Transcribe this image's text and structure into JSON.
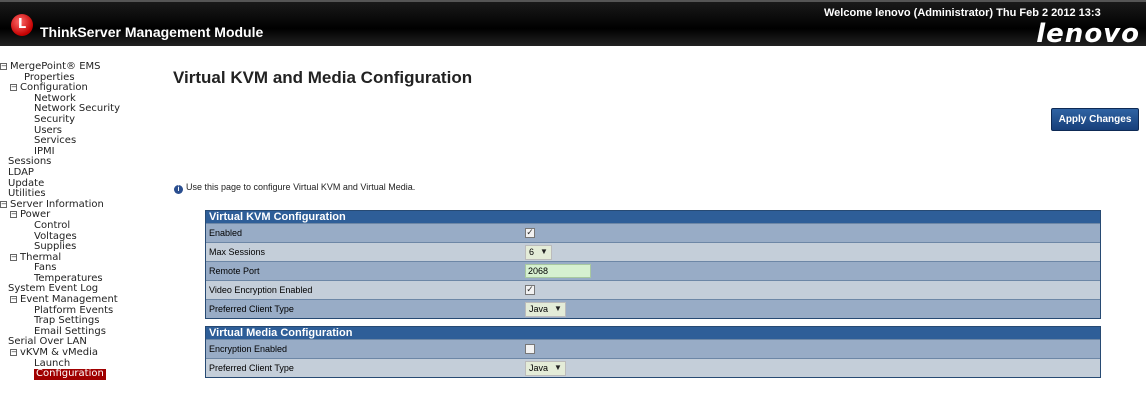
{
  "header": {
    "logo_glyph": "L",
    "product": "ThinkServer Management Module",
    "welcome": "Welcome lenovo (Administrator) Thu Feb 2 2012 13:3",
    "brand": "lenovo"
  },
  "nav": {
    "items": [
      {
        "label": "MergePoint® EMS",
        "level": 0,
        "toggle": true
      },
      {
        "label": "Properties",
        "level": 1,
        "toggle": false
      },
      {
        "label": "Configuration",
        "level": 1,
        "toggle": true
      },
      {
        "label": "Network",
        "level": 2
      },
      {
        "label": "Network Security",
        "level": 2
      },
      {
        "label": "Security",
        "level": 2
      },
      {
        "label": "Users",
        "level": 2
      },
      {
        "label": "Services",
        "level": 2
      },
      {
        "label": "IPMI",
        "level": 2
      },
      {
        "label": "Sessions",
        "level": 0
      },
      {
        "label": "LDAP",
        "level": 0
      },
      {
        "label": "Update",
        "level": 0
      },
      {
        "label": "Utilities",
        "level": 0
      },
      {
        "label": "Server Information",
        "level": 0,
        "toggle": true
      },
      {
        "label": "Power",
        "level": 1,
        "toggle": true
      },
      {
        "label": "Control",
        "level": 2
      },
      {
        "label": "Voltages",
        "level": 2
      },
      {
        "label": "Supplies",
        "level": 2
      },
      {
        "label": "Thermal",
        "level": 1,
        "toggle": true
      },
      {
        "label": "Fans",
        "level": 2
      },
      {
        "label": "Temperatures",
        "level": 2
      },
      {
        "label": "System Event Log",
        "level": 0
      },
      {
        "label": "Event Management",
        "level": 1,
        "toggle": true
      },
      {
        "label": "Platform Events",
        "level": 2
      },
      {
        "label": "Trap Settings",
        "level": 2
      },
      {
        "label": "Email Settings",
        "level": 2
      },
      {
        "label": "Serial Over LAN",
        "level": 0
      },
      {
        "label": "vKVM & vMedia",
        "level": 1,
        "toggle": true
      },
      {
        "label": "Launch",
        "level": 2
      },
      {
        "label": "Configuration",
        "level": 2,
        "active": true
      }
    ],
    "toggle_glyph": "−"
  },
  "main": {
    "title": "Virtual KVM and Media Configuration",
    "apply_label": "Apply Changes",
    "info_icon": "i",
    "info_text": "Use this page to configure Virtual KVM and Virtual Media."
  },
  "kvm": {
    "header": "Virtual KVM Configuration",
    "rows": {
      "enabled": {
        "label": "Enabled",
        "checked": true
      },
      "max_sessions": {
        "label": "Max Sessions",
        "value": "6"
      },
      "remote_port": {
        "label": "Remote Port",
        "value": "2068"
      },
      "video_encryption": {
        "label": "Video Encryption Enabled",
        "checked": true
      },
      "preferred_client": {
        "label": "Preferred Client Type",
        "value": "Java"
      }
    }
  },
  "media": {
    "header": "Virtual Media Configuration",
    "rows": {
      "encryption": {
        "label": "Encryption Enabled",
        "checked": false
      },
      "preferred_client": {
        "label": "Preferred Client Type",
        "value": "Java"
      }
    }
  },
  "glyphs": {
    "check": "✓",
    "dropdown": "▼"
  },
  "colors": {
    "header_bg": "#000000",
    "panel_header": "#2e5e98",
    "row_dark": "#98acc6",
    "row_light": "#c4ced9",
    "active_nav": "#a00000",
    "apply_button": "#1f4d8c"
  }
}
